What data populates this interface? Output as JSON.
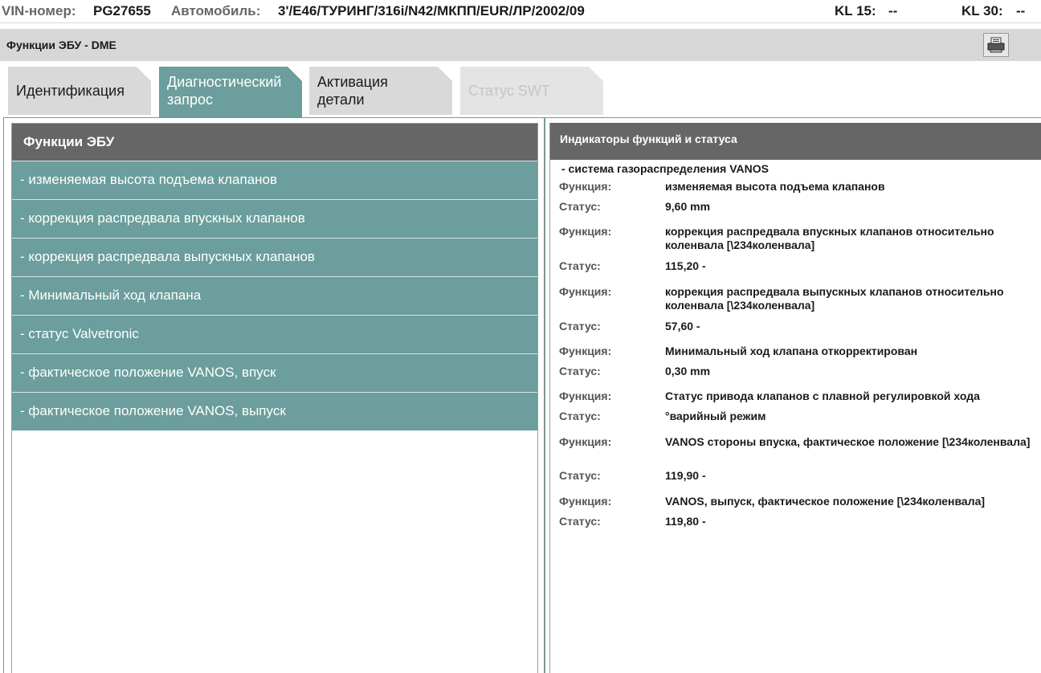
{
  "header": {
    "vin_label": "VIN-номер:",
    "vin_value": "PG27655",
    "car_label": "Автомобиль:",
    "car_value": "3'/E46/ТУРИНГ/316i/N42/МКПП/EUR/ЛР/2002/09",
    "kl15_label": "KL 15:",
    "kl15_value": "--",
    "kl30_label": "KL 30:",
    "kl30_value": "--"
  },
  "titlebar": {
    "title": "Функции ЭБУ - DME",
    "print_icon": "printer-icon"
  },
  "tabs": [
    {
      "lines": [
        "Идентификация"
      ],
      "state": "inactive"
    },
    {
      "lines": [
        "Диагностический",
        "запрос"
      ],
      "state": "active"
    },
    {
      "lines": [
        "Активация",
        "детали"
      ],
      "state": "inactive"
    },
    {
      "lines": [
        "Статус SWT"
      ],
      "state": "disabled"
    }
  ],
  "left_panel": {
    "header": "Функции ЭБУ",
    "items": [
      "- изменяемая высота подъема клапанов",
      "- коррекция распредвала впускных клапанов",
      "- коррекция распредвала выпускных клапанов",
      "- Минимальный ход клапана",
      "- статус Valvetronic",
      "- фактическое положение VANOS, впуск",
      "- фактическое положение VANOS, выпуск"
    ]
  },
  "right_panel": {
    "header": "Индикаторы функций и статуса",
    "section": "- система газораспределения VANOS",
    "function_label": "Функция:",
    "status_label": "Статус:",
    "rows": [
      {
        "function": "изменяемая высота подъема клапанов",
        "status": "9,60  mm"
      },
      {
        "function": "коррекция распредвала впускных клапанов относительно коленвала [\\234коленвала]",
        "status": "115,20  -"
      },
      {
        "function": "коррекция распредвала выпускных клапанов относительно коленвала [\\234коленвала]",
        "status": "57,60  -"
      },
      {
        "function": "Минимальный ход клапана откорректирован",
        "status": "0,30  mm"
      },
      {
        "function": "Статус привода клапанов с плавной регулировкой хода",
        "status": "°варийный режим"
      },
      {
        "function": "VANOS стороны впуска, фактическое положение [\\234коленвала]",
        "status": "119,90  -"
      },
      {
        "function": "VANOS, выпуск, фактическое положение [\\234коленвала]",
        "status": "119,80  -"
      }
    ]
  },
  "colors": {
    "accent_teal": "#6b9e9c",
    "header_gray": "#666666",
    "titlebar_gray": "#d7d7d7"
  }
}
